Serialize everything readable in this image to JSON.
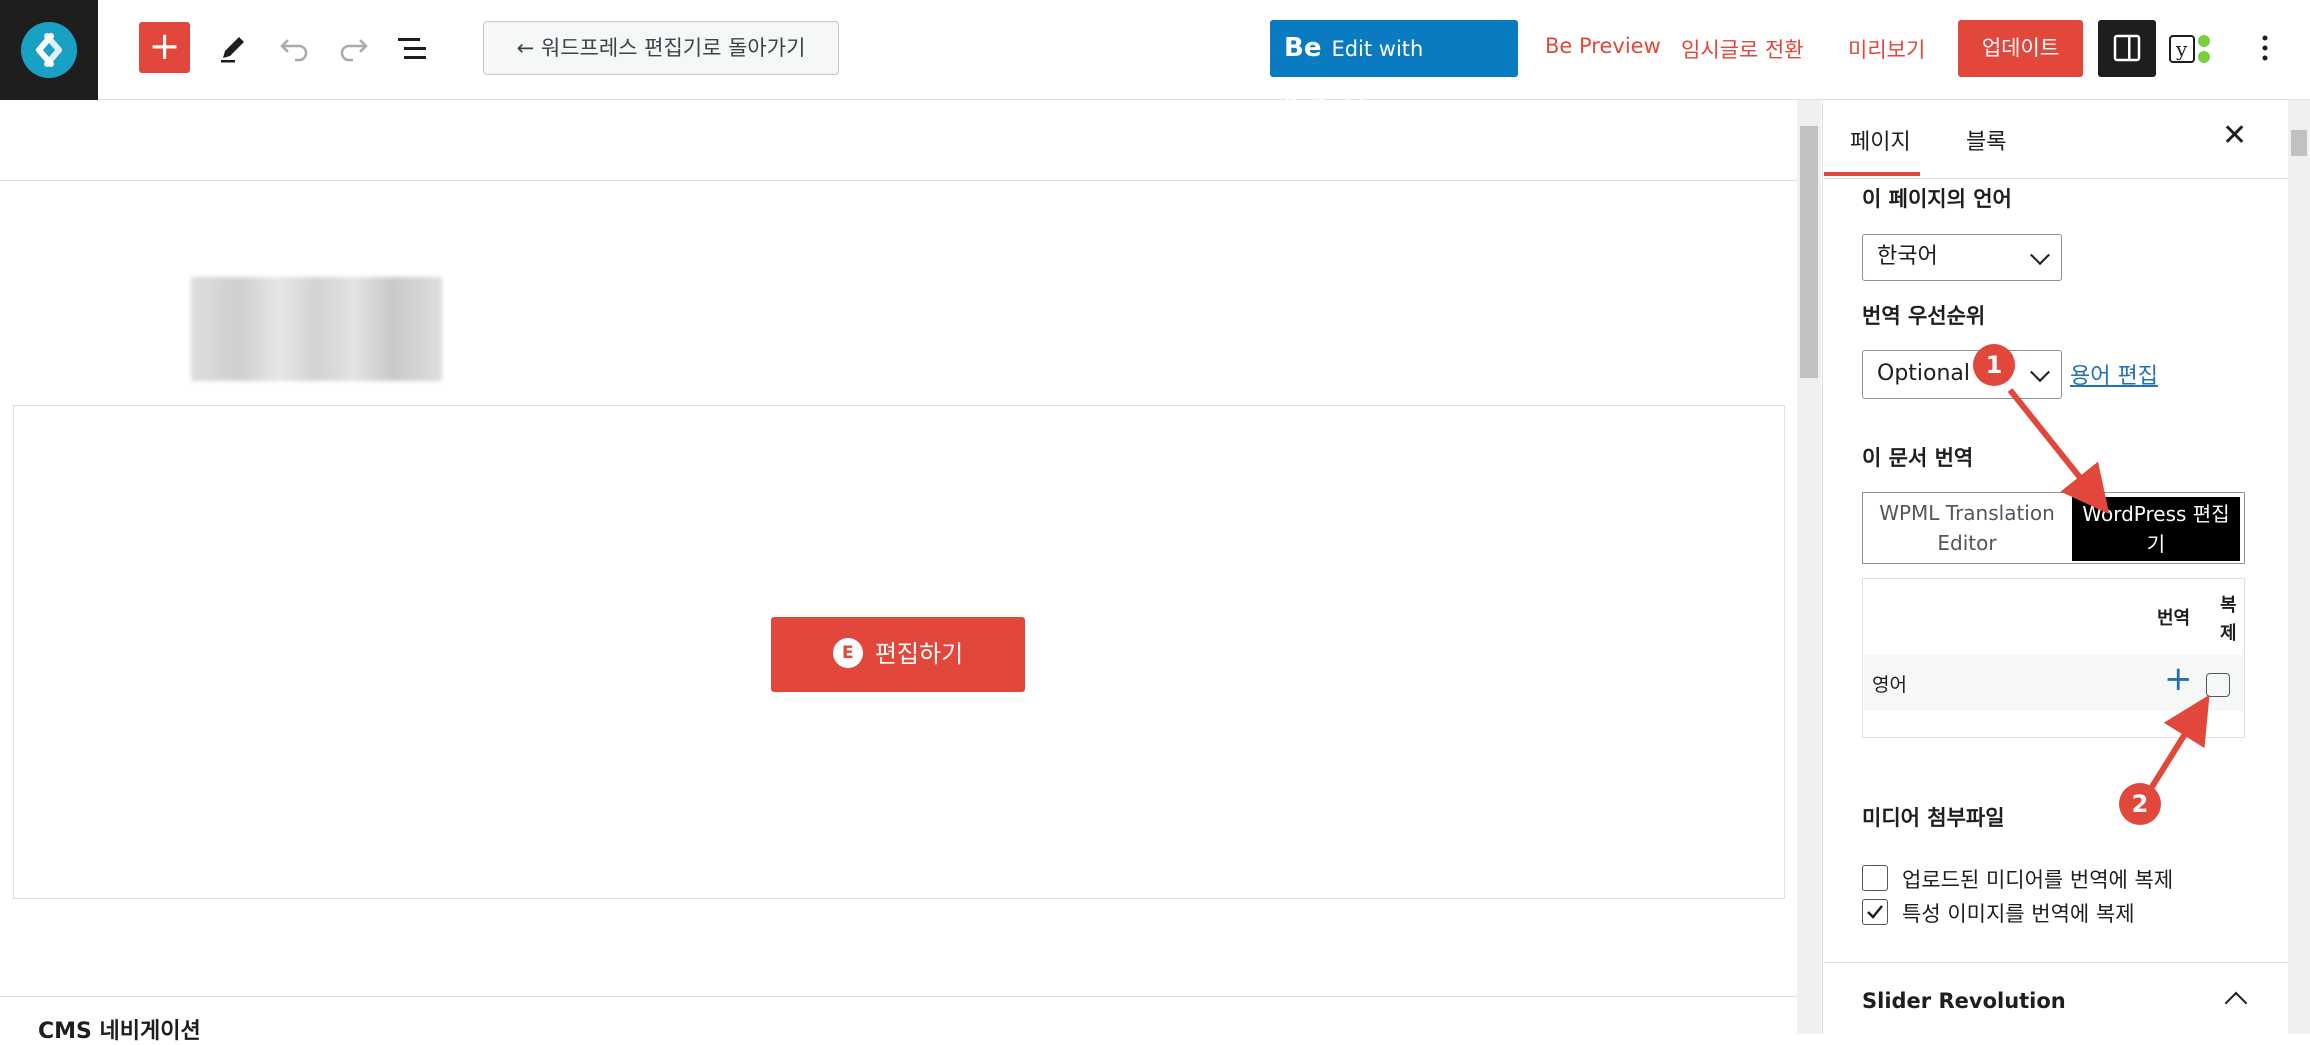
{
  "toolbar": {
    "back_to_wp_editor": "← 워드프레스 편집기로 돌아가기",
    "bebuilder_prefix": "Be",
    "bebuilder_label": "Edit with BeBuilder",
    "be_preview": "Be Preview",
    "switch_to_draft": "임시글로 전환",
    "preview": "미리보기",
    "update": "업데이트",
    "yoast_letter": "y"
  },
  "canvas": {
    "edit_with_elementor": "편집하기",
    "meta_box_title": "CMS 네비게이션"
  },
  "sidebar": {
    "tabs": [
      "페이지",
      "블록"
    ],
    "close": "✕",
    "page_language_label": "이 페이지의 언어",
    "page_language_value": "한국어",
    "translation_priority_label": "번역 우선순위",
    "translation_priority_value": "Optional",
    "glossary_link": "용어 편집",
    "translate_doc_label": "이 문서 번역",
    "wpml_editor_line1": "WPML Translation",
    "wpml_editor_line2": "Editor",
    "wp_editor_line1": "WordPress 편집",
    "wp_editor_line2": "기",
    "table": {
      "col_translate": "번역",
      "col_duplicate": "복제",
      "language": "영어",
      "add_icon": "+"
    },
    "media_label": "미디어 첨부파일",
    "media_options": [
      {
        "label": "업로드된 미디어를 번역에 복제",
        "checked": false
      },
      {
        "label": "특성 이미지를 번역에 복제",
        "checked": true
      }
    ],
    "slider_revolution": "Slider Revolution"
  },
  "annotations": [
    "1",
    "2"
  ],
  "colors": {
    "accent_red": "#e2473b",
    "bebuilder_blue": "#0a7ac1",
    "link_blue": "#2271b1",
    "wpml_logo": "#19a1c4"
  }
}
